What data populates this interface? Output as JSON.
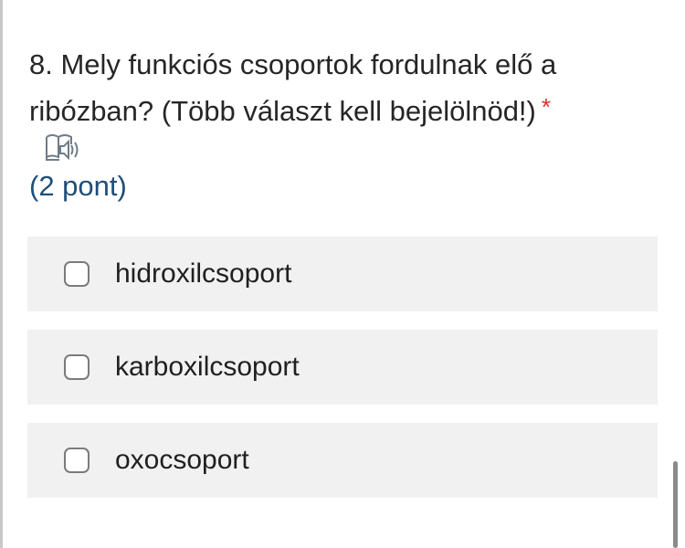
{
  "question": {
    "text": "8. Mely funkciós csoportok fordulnak elő a ribózban? (Több választ kell bejelölnöd!)",
    "required_marker": "*",
    "points": "(2 pont)",
    "audio_icon": "speaker-book-icon"
  },
  "options": [
    {
      "label": "hidroxilcsoport",
      "checked": false
    },
    {
      "label": "karboxilcsoport",
      "checked": false
    },
    {
      "label": "oxocsoport",
      "checked": false
    }
  ],
  "colors": {
    "option_background": "#f1f1f1",
    "required": "#d93025",
    "points_text": "#1f4e79"
  }
}
